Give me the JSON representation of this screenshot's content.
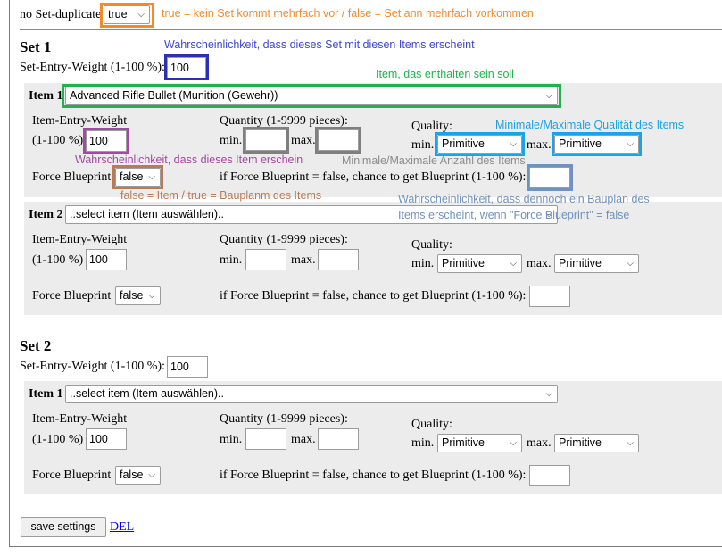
{
  "top": {
    "label": "no Set-duplicate",
    "value": "true"
  },
  "sets": [
    {
      "title": "Set 1",
      "weight_label": "Set-Entry-Weight (1-100 %):",
      "weight_value": "100",
      "items": [
        {
          "label": "Item 1",
          "selected": "Advanced Rifle Bullet (Munition (Gewehr))",
          "entry_weight_label_1": "Item-Entry-Weight",
          "entry_weight_label_2": "(1-100 %)",
          "entry_weight_value": "100",
          "quantity_label": "Quantity (1-9999 pieces):",
          "min_label": "min.",
          "min_value": "",
          "max_label": "max.",
          "max_value": "",
          "quality_label": "Quality:",
          "quality_min_label": "min.",
          "quality_min": "Primitive",
          "quality_max_label": "max.",
          "quality_max": "Primitive",
          "force_label": "Force Blueprint",
          "force_value": "false",
          "chance_label": "if Force Blueprint = false, chance to get Blueprint (1-100 %):",
          "chance_value": ""
        },
        {
          "label": "Item 2",
          "selected": "..select item (Item auswählen)..",
          "entry_weight_label_1": "Item-Entry-Weight",
          "entry_weight_label_2": "(1-100 %)",
          "entry_weight_value": "100",
          "quantity_label": "Quantity (1-9999 pieces):",
          "min_label": "min.",
          "min_value": "",
          "max_label": "max.",
          "max_value": "",
          "quality_label": "Quality:",
          "quality_min_label": "min.",
          "quality_min": "Primitive",
          "quality_max_label": "max.",
          "quality_max": "Primitive",
          "force_label": "Force Blueprint",
          "force_value": "false",
          "chance_label": "if Force Blueprint = false, chance to get Blueprint (1-100 %):",
          "chance_value": ""
        }
      ]
    },
    {
      "title": "Set 2",
      "weight_label": "Set-Entry-Weight (1-100 %):",
      "weight_value": "100",
      "items": [
        {
          "label": "Item 1",
          "selected": "..select item (Item auswählen)..",
          "entry_weight_label_1": "Item-Entry-Weight",
          "entry_weight_label_2": "(1-100 %)",
          "entry_weight_value": "100",
          "quantity_label": "Quantity (1-9999 pieces):",
          "min_label": "min.",
          "min_value": "",
          "max_label": "max.",
          "max_value": "",
          "quality_label": "Quality:",
          "quality_min_label": "min.",
          "quality_min": "Primitive",
          "quality_max_label": "max.",
          "quality_max": "Primitive",
          "force_label": "Force Blueprint",
          "force_value": "false",
          "chance_label": "if Force Blueprint = false, chance to get Blueprint (1-100 %):",
          "chance_value": ""
        }
      ]
    }
  ],
  "actions": {
    "save_label": "save settings",
    "del_label": "DEL"
  },
  "annotations": {
    "no_duplicate": "true = kein Set kommt mehrfach vor / false = Set ann mehrfach vorkommen",
    "set_weight": "Wahrscheinlichkeit, dass dieses Set mit diesen Items erscheint",
    "item": "Item, das enthalten sein soll",
    "quality": "Minimale/Maximale Qualität des Items",
    "item_weight": "Wahrscheinlichkeit, dass dieses Item erschein",
    "quantity": "Minimale/Maximale Anzahl des Items",
    "force_blueprint": "false = Item / true = Bauplanm des Items",
    "chance_line1": "Wahrscheinlichkeit, dass dennoch ein Bauplan des",
    "chance_line2": "Items erscheint, wenn \"Force Blueprint\" = false"
  },
  "colors": {
    "orange": "#f58a2a",
    "navy": "#2b2fb3",
    "green": "#22b14c",
    "blue": "#1aa3e8",
    "purple": "#a349a4",
    "gray": "#7f7f7f",
    "brown": "#b97a57",
    "steel": "#7092be",
    "ann_blue": "#3f48cc",
    "ann_gray": "#8c8c8c",
    "ann_steel": "#7092be"
  }
}
